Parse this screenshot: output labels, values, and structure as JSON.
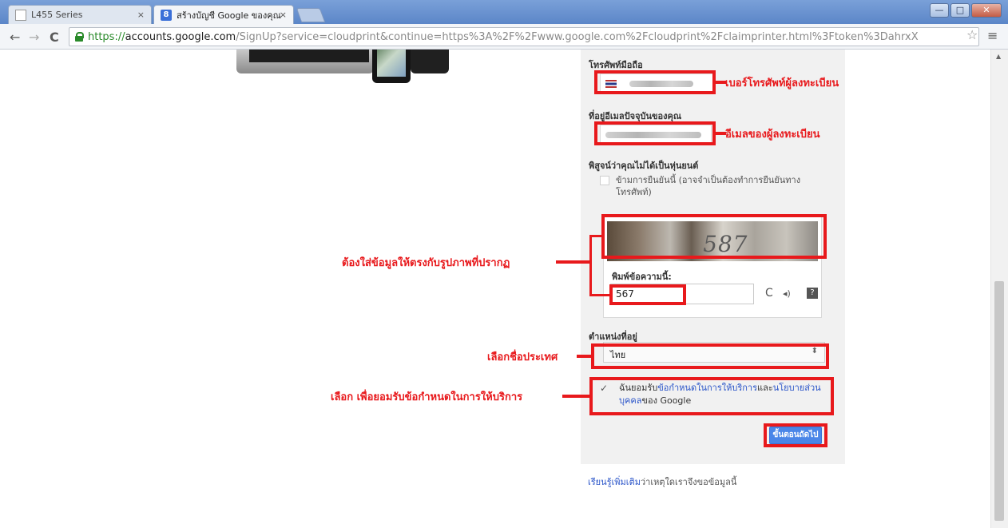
{
  "browser": {
    "tabs": [
      {
        "label": "L455 Series",
        "close": "×"
      },
      {
        "label": "สร้างบัญชี Google ของคุณ",
        "close": "×"
      }
    ],
    "window_buttons": {
      "minimize": "—",
      "maximize": "□",
      "close": "✕"
    },
    "nav": {
      "back": "←",
      "forward": "→",
      "reload": "C"
    },
    "url": {
      "scheme": "https://",
      "host": "accounts.google.com",
      "path": "/SignUp?service=cloudprint&continue=https%3A%2F%2Fwww.google.com%2Fcloudprint%2Fclaimprinter.html%3Ftoken%3DahrxX"
    },
    "bookmark_star": "☆",
    "menu_icon": "≡"
  },
  "form": {
    "phone_label": "โทรศัพท์มือถือ",
    "email_label": "ที่อยู่อีเมลปัจจุบันของคุณ",
    "robot_label": "พิสูจน์ว่าคุณไม่ได้เป็นหุ่นยนต์",
    "skip_verification": "ข้ามการยืนยันนี้ (อาจจำเป็นต้องทำการยืนยันทาง โทรศัพท์)",
    "captcha_image_text": "587",
    "captcha_prompt": "พิมพ์ข้อความนี้:",
    "captcha_value": "567",
    "captcha_icons": {
      "refresh": "C",
      "audio": "◂)",
      "help": "?"
    },
    "location_label": "ตำแหน่งที่อยู่",
    "location_value": "ไทย",
    "select_arrow": "⬍",
    "tos_check": "✓",
    "tos_prefix": "ฉันยอมรับ",
    "tos_link1": "ข้อกำหนดในการให้บริการ",
    "tos_mid": "และ",
    "tos_link2": "นโยบายส่วน บุคคล",
    "tos_suffix": "ของ Google",
    "next_button": "ขั้นตอนถัดไป",
    "learn_more_link": "เรียนรู้เพิ่มเติม",
    "learn_more_text": "ว่าเหตุใดเราจึงขอข้อมูลนี้"
  },
  "annotations": {
    "phone": "เบอร์โทรศัพท์ผู้ลงทะเบียน",
    "email": "อีเมลของผู้ลงทะเบียน",
    "captcha": "ต้องใส่ข้อมูลให้ตรงกับรูปภาพที่ปรากฏ",
    "country": "เลือกชื่อประเทศ",
    "tos": "เลือก เพื่อยอมรับข้อกำหนดในการให้บริการ"
  },
  "colors": {
    "annotation": "#e8191c",
    "link": "#2b55c9",
    "button": "#4a86e8"
  }
}
